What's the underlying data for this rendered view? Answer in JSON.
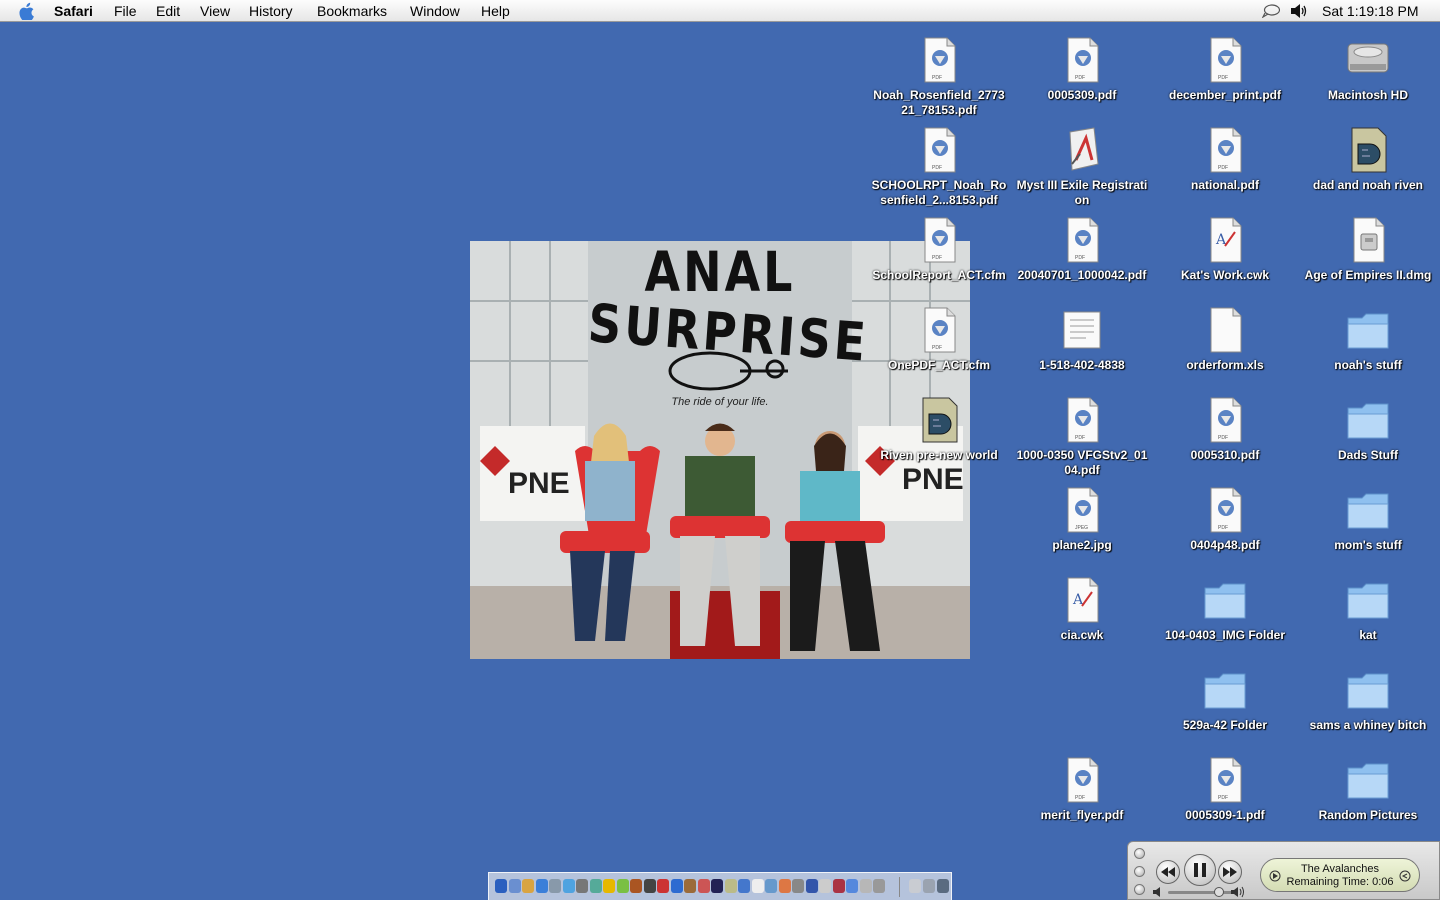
{
  "menubar": {
    "app": "Safari",
    "menus": [
      "File",
      "Edit",
      "View",
      "History",
      "Bookmarks",
      "Window",
      "Help"
    ],
    "clock": "Sat 1:19:18 PM"
  },
  "photo": {
    "title_line1": "ANAL",
    "title_line2": "SURPRISE",
    "tagline": "The ride of your life.",
    "logo_left": "PNE",
    "logo_right": "PNE"
  },
  "icons": [
    {
      "label": "Noah_Rosenfield_277321_78153.pdf",
      "kind": "pdf"
    },
    {
      "label": "0005309.pdf",
      "kind": "pdf"
    },
    {
      "label": "december_print.pdf",
      "kind": "pdf"
    },
    {
      "label": "Macintosh HD",
      "kind": "disk"
    },
    {
      "label": "SCHOOLRPT_Noah_Rosenfield_2...8153.pdf",
      "kind": "pdf"
    },
    {
      "label": "Myst III Exile Registration",
      "kind": "app"
    },
    {
      "label": "national.pdf",
      "kind": "pdf"
    },
    {
      "label": "dad and noah riven",
      "kind": "game"
    },
    {
      "label": "SchoolReport_ACT.cfm",
      "kind": "pdf"
    },
    {
      "label": "20040701_1000042.pdf",
      "kind": "pdf"
    },
    {
      "label": "Kat's Work.cwk",
      "kind": "cwk"
    },
    {
      "label": "Age of Empires II.dmg",
      "kind": "dmg"
    },
    {
      "label": "OnePDF_ACT.cfm",
      "kind": "pdf"
    },
    {
      "label": "1-518-402-4838",
      "kind": "text"
    },
    {
      "label": "orderform.xls",
      "kind": "doc"
    },
    {
      "label": "noah's stuff",
      "kind": "folder"
    },
    {
      "label": "Riven pre-new world",
      "kind": "game"
    },
    {
      "label": "1000-0350 VFGStv2_0104.pdf",
      "kind": "pdf"
    },
    {
      "label": "0005310.pdf",
      "kind": "pdf"
    },
    {
      "label": "Dads Stuff",
      "kind": "folder"
    },
    {
      "label": "plane2.jpg",
      "kind": "jpeg"
    },
    {
      "label": "0404p48.pdf",
      "kind": "pdf"
    },
    {
      "label": "mom's stuff",
      "kind": "folder"
    },
    {
      "label": "cia.cwk",
      "kind": "cwk"
    },
    {
      "label": "104-0403_IMG Folder",
      "kind": "folder"
    },
    {
      "label": "kat",
      "kind": "folder"
    },
    {
      "label": "529a-42 Folder",
      "kind": "folder"
    },
    {
      "label": "sams a whiney bitch",
      "kind": "folder"
    },
    {
      "label": "merit_flyer.pdf",
      "kind": "pdf"
    },
    {
      "label": "0005309-1.pdf",
      "kind": "pdf"
    },
    {
      "label": "Random Pictures",
      "kind": "folder"
    }
  ],
  "icon_badges": {
    "pdf": "PDF",
    "jpeg": "JPEG"
  },
  "player": {
    "track": "The Avalanches",
    "remaining": "Remaining Time: 0:06"
  },
  "colors": {
    "desktop": "#4169b0",
    "folder": "#8fc0ef",
    "lcd": "#e4ebc8"
  }
}
